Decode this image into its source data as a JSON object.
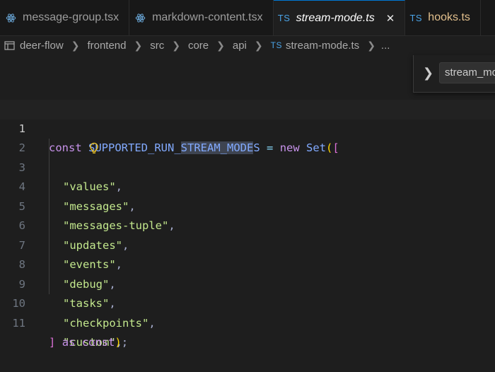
{
  "tabs": [
    {
      "icon": "react-icon",
      "label": "message-group.tsx",
      "active": false
    },
    {
      "icon": "react-icon",
      "label": "markdown-content.tsx",
      "active": false
    },
    {
      "icon": "ts-icon",
      "badge": "TS",
      "label": "stream-mode.ts",
      "active": true,
      "close": "✕"
    },
    {
      "icon": "ts-icon",
      "badge": "TS",
      "label": "hooks.ts",
      "active": false
    }
  ],
  "breadcrumb": {
    "items": [
      "deer-flow",
      "frontend",
      "src",
      "core",
      "api"
    ],
    "file_badge": "TS",
    "file": "stream-mode.ts",
    "ellipsis": "..."
  },
  "find_widget": {
    "value": "stream_mode"
  },
  "editor": {
    "line_numbers": [
      "1",
      "2",
      "3",
      "4",
      "5",
      "6",
      "7",
      "8",
      "9",
      "10",
      "11"
    ],
    "current_line": 1,
    "line1": {
      "kw": "const",
      "name_pre": "SUPPORTED_RUN_",
      "name_hl": "STREAM_MODE",
      "name_post": "S",
      "eq": "=",
      "new": "new",
      "fn": "Set",
      "paren": "(",
      "bracket": "["
    },
    "strings": [
      "\"values\"",
      "\"messages\"",
      "\"messages-tuple\"",
      "\"updates\"",
      "\"events\"",
      "\"debug\"",
      "\"tasks\"",
      "\"checkpoints\"",
      "\"custom\""
    ],
    "comma": ",",
    "line11": {
      "bracket": "]",
      "as": "as",
      "const": "const",
      "paren": ")",
      "semi": ";"
    }
  },
  "colors": {
    "keyword": "#c792ea",
    "identifier": "#82aaff",
    "string": "#c3e88d",
    "bracket_outer": "#ffd700",
    "bracket_inner": "#da70d6",
    "accent": "#0078d4"
  }
}
